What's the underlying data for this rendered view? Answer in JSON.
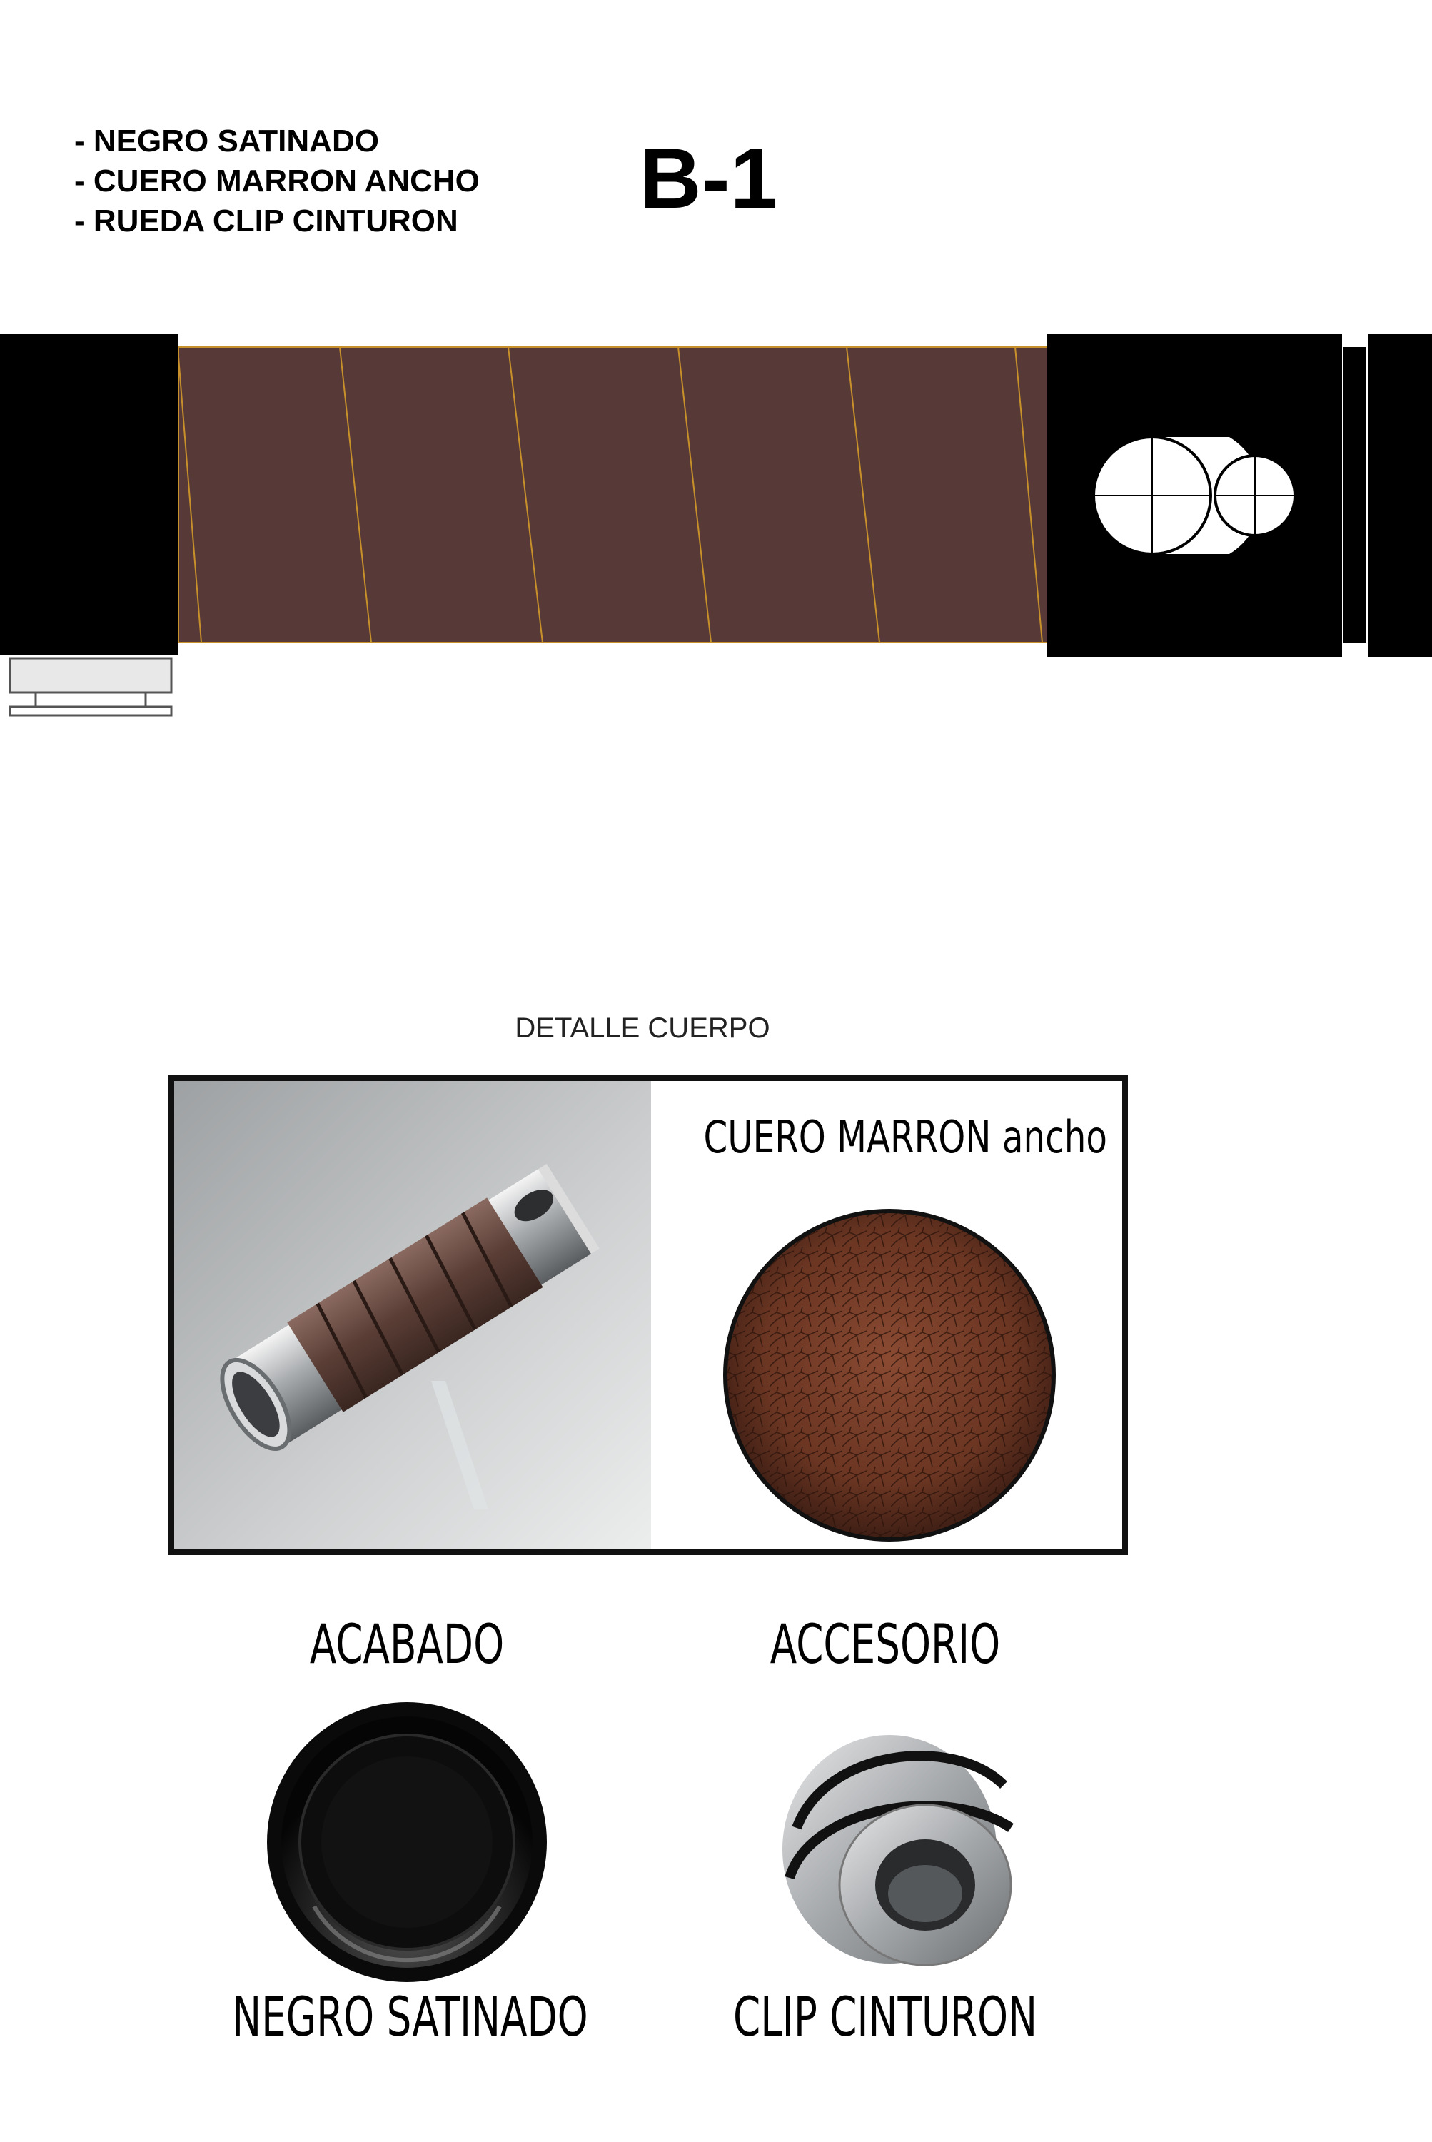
{
  "header": {
    "specs": [
      "- NEGRO SATINADO",
      "- CUERO MARRON ANCHO",
      "- RUEDA CLIP CINTURON"
    ],
    "model_code": "B-1"
  },
  "hilt": {
    "colors": {
      "body": "#000000",
      "leather": "#573a37",
      "leather_seam": "#c8902a",
      "clip": "#e8e8e8"
    }
  },
  "detail": {
    "title": "DETALLE CUERPO",
    "leather_label": "CUERO MARRON ancho"
  },
  "options": {
    "finish_heading": "ACABADO",
    "finish_value": "NEGRO SATINADO",
    "accessory_heading": "ACCESORIO",
    "accessory_value": "CLIP CINTURON"
  }
}
